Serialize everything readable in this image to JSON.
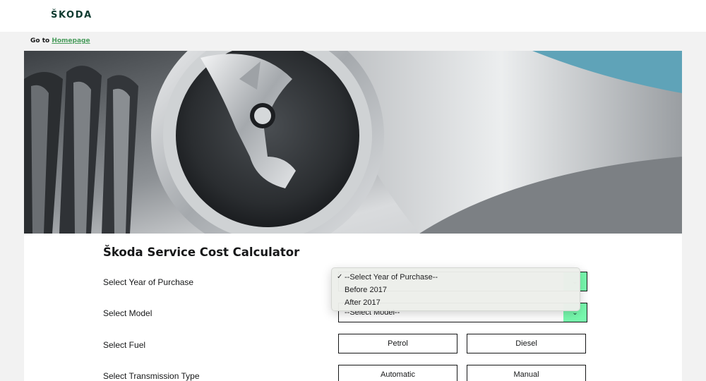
{
  "header": {
    "logo_text": "ŠKODA"
  },
  "breadcrumb": {
    "prefix": "Go to ",
    "link": "Homepage"
  },
  "hero": {
    "image_alt": "Škoda badge close-up"
  },
  "calculator": {
    "title": "Škoda Service Cost Calculator",
    "rows": {
      "year": {
        "label": "Select Year of Purchase"
      },
      "model": {
        "label": "Select Model",
        "value": "--Select Model--"
      },
      "fuel": {
        "label": "Select Fuel",
        "options": [
          "Petrol",
          "Diesel"
        ]
      },
      "transmission": {
        "label": "Select Transmission Type",
        "options": [
          "Automatic",
          "Manual"
        ]
      }
    }
  },
  "year_dropdown": {
    "check": "✓",
    "options": [
      "--Select Year of Purchase--",
      "Before 2017",
      "After 2017"
    ],
    "selected_index": 0
  },
  "colors": {
    "accent": "#78faae",
    "brand_dark": "#0e3a2f",
    "link": "#4a9c5d"
  },
  "icons": {
    "caret": "chevron-down-icon",
    "check": "checkmark-icon"
  }
}
